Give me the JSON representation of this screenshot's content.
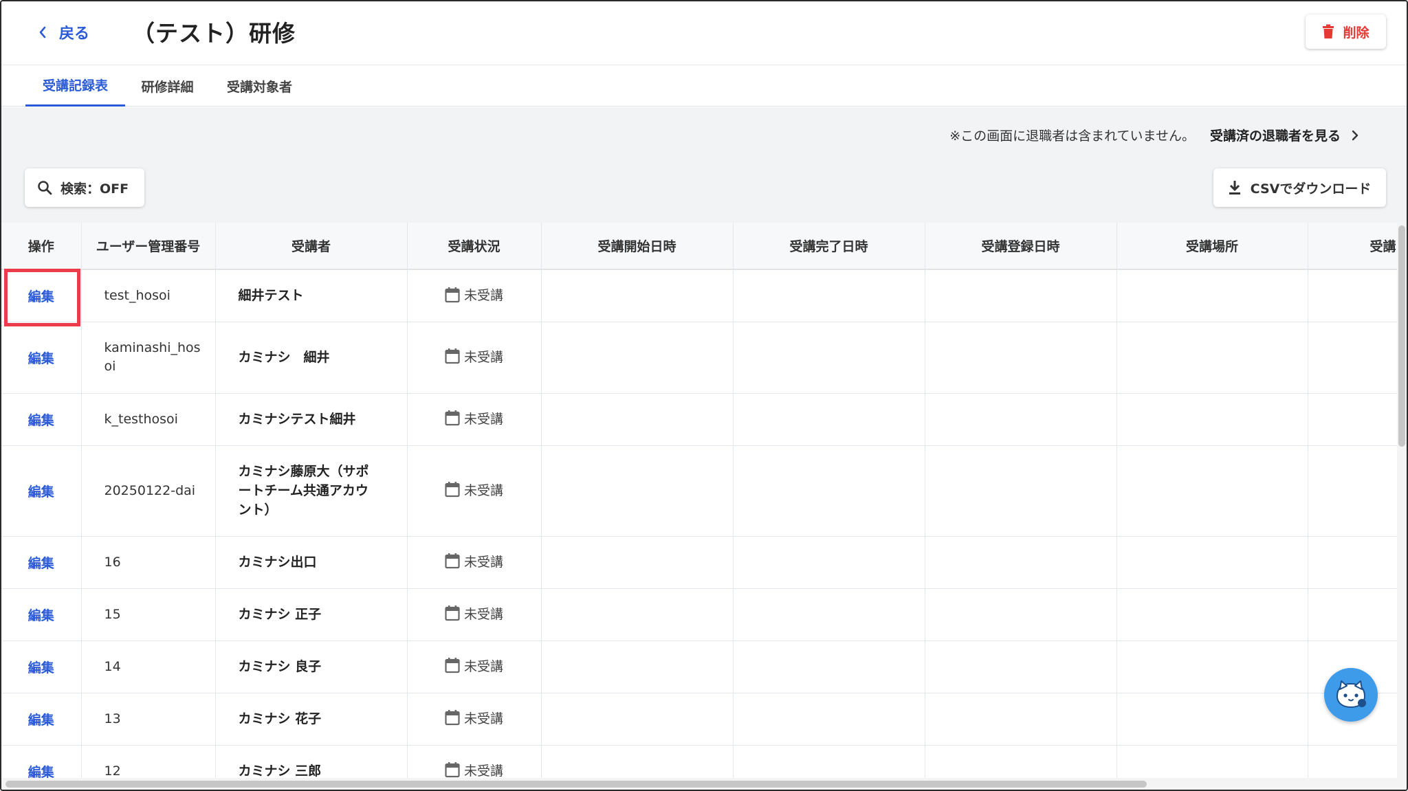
{
  "header": {
    "back_label": "戻る",
    "title": "（テスト）研修",
    "delete_label": "削除"
  },
  "tabs": [
    {
      "label": "受講記録表",
      "active": true
    },
    {
      "label": "研修詳細",
      "active": false
    },
    {
      "label": "受講対象者",
      "active": false
    }
  ],
  "notice": {
    "text": "※この画面に退職者は含まれていません。",
    "link_label": "受講済の退職者を見る"
  },
  "toolbar": {
    "search_label": "検索：OFF",
    "csv_label": "CSVでダウンロード"
  },
  "table": {
    "columns": [
      "操作",
      "ユーザー管理番号",
      "受講者",
      "受講状況",
      "受講開始日時",
      "受講完了日時",
      "受講登録日時",
      "受講場所",
      "受講"
    ],
    "rows": [
      {
        "action": "編集",
        "user_id": "test_hosoi",
        "name": "細井テスト",
        "status": "未受講"
      },
      {
        "action": "編集",
        "user_id": "kaminashi_hosoi",
        "name": "カミナシ　細井",
        "status": "未受講"
      },
      {
        "action": "編集",
        "user_id": "k_testhosoi",
        "name": "カミナシテスト細井",
        "status": "未受講"
      },
      {
        "action": "編集",
        "user_id": "20250122-dai",
        "name": "カミナシ藤原大（サポートチーム共通アカウント）",
        "status": "未受講"
      },
      {
        "action": "編集",
        "user_id": "16",
        "name": "カミナシ出口",
        "status": "未受講"
      },
      {
        "action": "編集",
        "user_id": "15",
        "name": "カミナシ 正子",
        "status": "未受講"
      },
      {
        "action": "編集",
        "user_id": "14",
        "name": "カミナシ 良子",
        "status": "未受講"
      },
      {
        "action": "編集",
        "user_id": "13",
        "name": "カミナシ 花子",
        "status": "未受講"
      },
      {
        "action": "編集",
        "user_id": "12",
        "name": "カミナシ 三郎",
        "status": "未受講"
      }
    ]
  },
  "colors": {
    "accent": "#2b5bd7",
    "danger": "#e53935",
    "highlight": "#ec3c4b",
    "background": "#f2f3f5"
  },
  "icons": [
    "chevron-left-icon",
    "trash-icon",
    "chevron-right-icon",
    "search-icon",
    "download-icon",
    "calendar-icon",
    "chat-bot-icon"
  ]
}
